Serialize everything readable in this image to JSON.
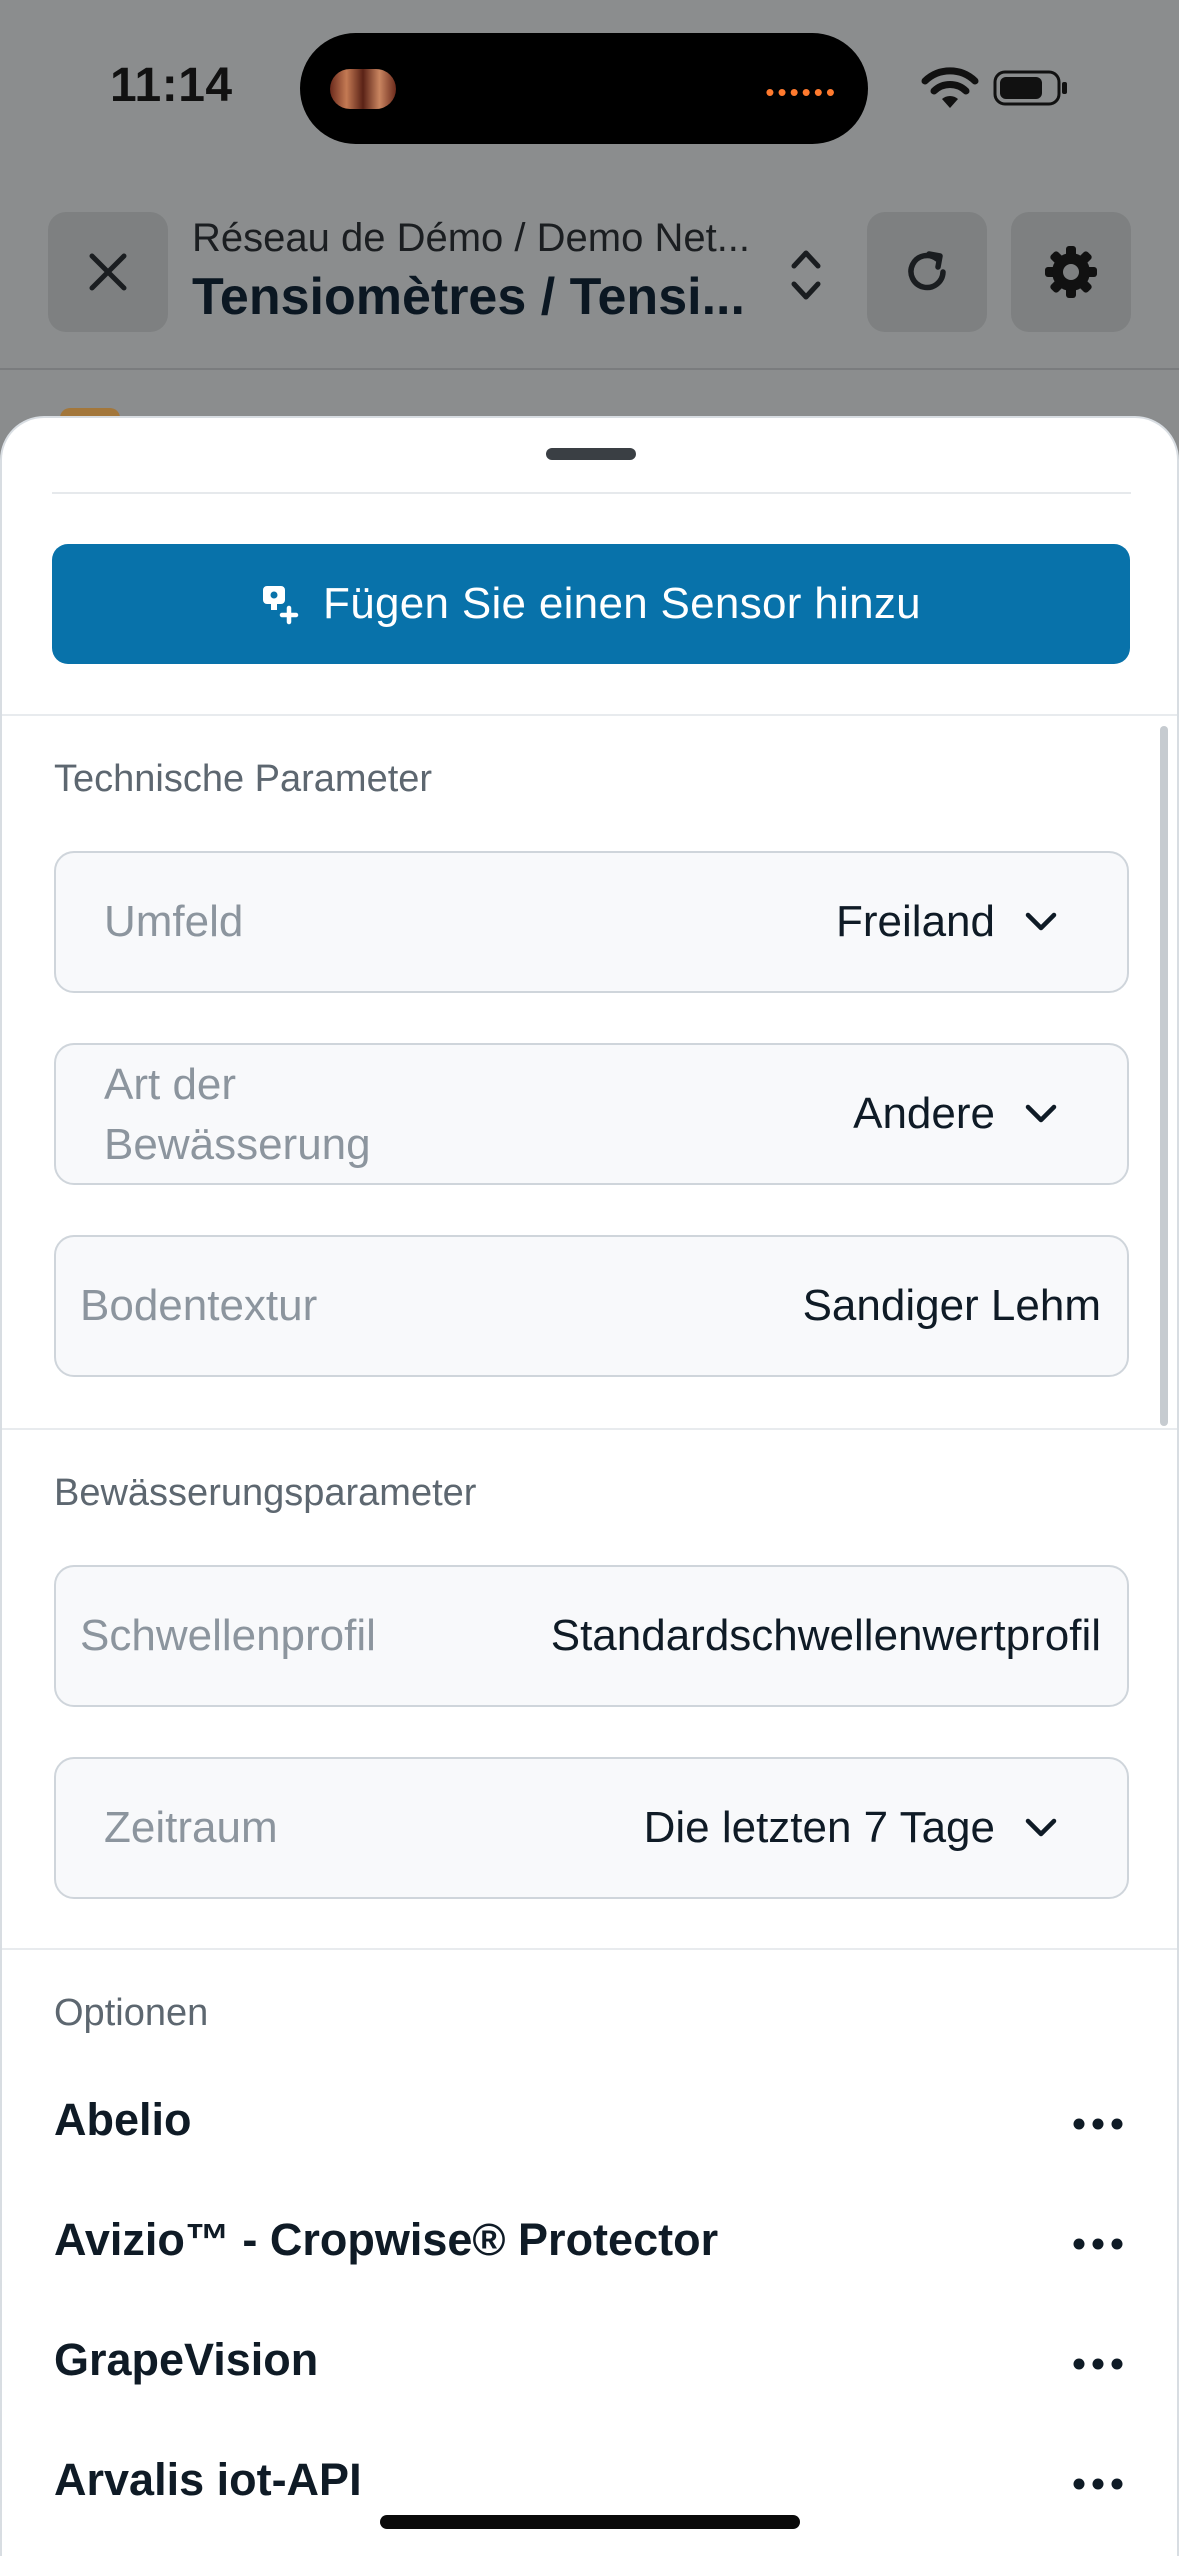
{
  "status_bar": {
    "time": "11:14"
  },
  "header": {
    "subtitle": "Réseau de Démo / Demo Net...",
    "title": "Tensiomètres / Tensi...",
    "icons": {
      "close": "close-icon",
      "switch": "chevron-up-down-icon",
      "refresh": "refresh-icon",
      "settings": "gear-icon"
    }
  },
  "sheet": {
    "add_sensor_button": {
      "label": "Fügen Sie einen Sensor hinzu",
      "icon": "sensor-plus-icon",
      "color": "#0872aa"
    },
    "technical": {
      "title": "Technische Parameter",
      "fields": [
        {
          "label": "Umfeld",
          "value": "Freiland",
          "dropdown": true
        },
        {
          "label_line1": "Art der",
          "label_line2": "Bewässerung",
          "value": "Andere",
          "dropdown": true
        },
        {
          "label": "Bodentextur",
          "value": "Sandiger Lehm",
          "dropdown": false
        }
      ]
    },
    "irrigation": {
      "title": "Bewässerungsparameter",
      "fields": [
        {
          "label": "Schwellenprofil",
          "value": "Standardschwellenwertprofil",
          "dropdown": false
        },
        {
          "label": "Zeitraum",
          "value": "Die letzten 7 Tage",
          "dropdown": true
        }
      ]
    },
    "options": {
      "title": "Optionen",
      "items": [
        {
          "label": "Abelio"
        },
        {
          "label": "Avizio™ - Cropwise® Protector"
        },
        {
          "label": "GrapeVision"
        },
        {
          "label": "Arvalis iot-API"
        }
      ]
    }
  }
}
